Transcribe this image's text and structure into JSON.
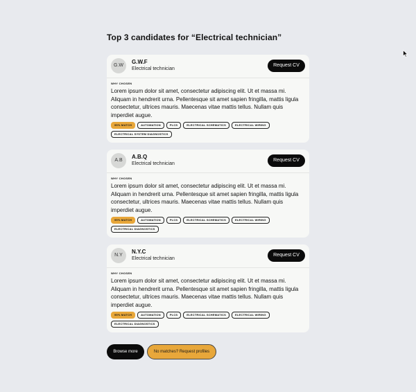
{
  "page": {
    "title": "Top 3 candidates for “Electrical technician”"
  },
  "labels": {
    "why_chosen": "WHY CHOSEN",
    "request_cv": "Request CV"
  },
  "candidates": [
    {
      "initials": "G.W",
      "name": "G.W.F",
      "role": "Electrical technician",
      "description": "Lorem ipsum dolor sit amet, consectetur adipiscing elit. Ut et massa mi. Aliquam in hendrerit urna. Pellentesque sit amet sapien fringilla, mattis ligula consectetur, ultrices mauris. Maecenas vitae mattis tellus. Nullam quis imperdiet augue.",
      "match": "95% MATCH",
      "tags": [
        "AUTOMATION",
        "PLCS",
        "ELECTRICAL SCHEMATICS",
        "ELECTRICAL WIRING",
        "ELECTRICAL SYSTEM DIAGNOSTICS"
      ]
    },
    {
      "initials": "A.B",
      "name": "A.B.Q",
      "role": "Electrical technician",
      "description": "Lorem ipsum dolor sit amet, consectetur adipiscing elit. Ut et massa mi. Aliquam in hendrerit urna. Pellentesque sit amet sapien fringilla, mattis ligula consectetur, ultrices mauris. Maecenas vitae mattis tellus. Nullam quis imperdiet augue.",
      "match": "95% MATCH",
      "tags": [
        "AUTOMATION",
        "PLCS",
        "ELECTRICAL SCHEMATICS",
        "ELECTRICAL WIRING",
        "ELECTRICAL  DIAGNOSTICS"
      ]
    },
    {
      "initials": "N.Y",
      "name": "N.Y.C",
      "role": "Electrical technician",
      "description": "Lorem ipsum dolor sit amet, consectetur adipiscing elit. Ut et massa mi. Aliquam in hendrerit urna. Pellentesque sit amet sapien fringilla, mattis ligula consectetur, ultrices mauris. Maecenas vitae mattis tellus. Nullam quis imperdiet augue.",
      "match": "95% MATCH",
      "tags": [
        "AUTOMATION",
        "PLCS",
        "ELECTRICAL SCHEMATICS",
        "ELECTRICAL WIRING",
        "ELECTRICAL DIAGNOSTICS"
      ]
    }
  ],
  "actions": {
    "browse_more": "Browse more",
    "request_profiles": "No matches? Request profiles"
  },
  "colors": {
    "background": "#e8eaee",
    "card": "#f7f8f6",
    "accent": "#e8a73a",
    "button_dark": "#0b0b0b"
  },
  "icons": {
    "cursor": "mouse-pointer-icon"
  }
}
